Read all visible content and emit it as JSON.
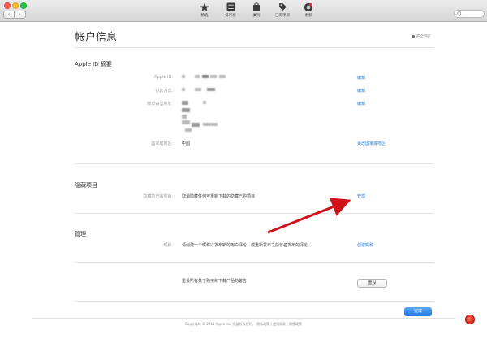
{
  "toolbar": {
    "items": [
      {
        "label": "精选",
        "icon": "star-icon"
      },
      {
        "label": "排行榜",
        "icon": "list-icon"
      },
      {
        "label": "类别",
        "icon": "bag-icon"
      },
      {
        "label": "已购项目",
        "icon": "tag-icon"
      },
      {
        "label": "更新",
        "icon": "update-icon"
      }
    ],
    "search_placeholder": "Q"
  },
  "page": {
    "title": "帐户信息",
    "secure_label": "安全浏览"
  },
  "apple_id_summary": {
    "title": "Apple ID 摘要",
    "rows": [
      {
        "label": "Apple ID:",
        "link": "编辑"
      },
      {
        "label": "付款方式:",
        "link": "编辑"
      },
      {
        "label": "帐单寄送地址:",
        "link": "编辑"
      },
      {
        "label": "国家或地区:",
        "value": "中国",
        "link": "更改国家或地区"
      }
    ]
  },
  "hidden_items": {
    "title": "隐藏项目",
    "label": "隐藏的已购项目:",
    "value": "取消隐藏任何可重新下载的隐藏已购项目",
    "link": "管理"
  },
  "manage": {
    "title": "管理",
    "nickname_label": "昵称:",
    "nickname_value": "请创建一个昵称以发布新的用户评论，或重新发布之前曾名发布的评论。",
    "nickname_link": "创建昵称",
    "reset_text": "重设所有关于购买和下载产品的警告",
    "reset_button": "重设"
  },
  "done_button": "完成",
  "footer": "Copyright © 2015 Apple Inc. 保留所有权利。  隐私政策  |  使用条款  |  销售政策",
  "annotation": {
    "arrow_color": "#d0121b"
  }
}
